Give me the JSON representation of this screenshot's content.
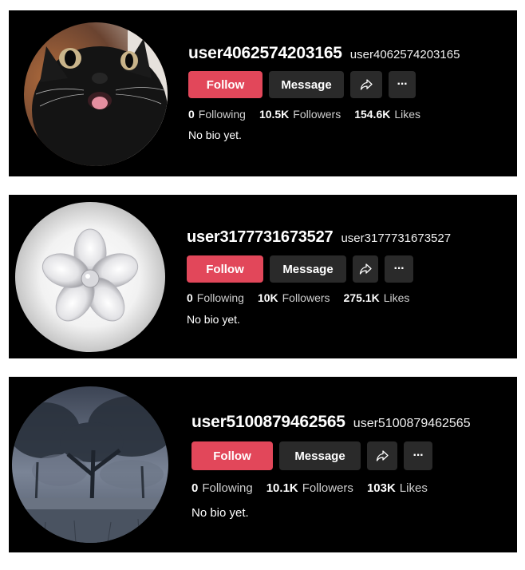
{
  "profiles": [
    {
      "username": "user4062574203165",
      "handle": "user4062574203165",
      "follow_label": "Follow",
      "message_label": "Message",
      "share_icon": "share-icon",
      "more_icon": "more-icon",
      "more_glyph": "···",
      "following_count": "0",
      "following_label": "Following",
      "followers_count": "10.5K",
      "followers_label": "Followers",
      "likes_count": "154.6K",
      "likes_label": "Likes",
      "bio": "No bio yet.",
      "avatar": "black-cat-photo"
    },
    {
      "username": "user3177731673527",
      "handle": "user3177731673527",
      "follow_label": "Follow",
      "message_label": "Message",
      "share_icon": "share-icon",
      "more_icon": "more-icon",
      "more_glyph": "···",
      "following_count": "0",
      "following_label": "Following",
      "followers_count": "10K",
      "followers_label": "Followers",
      "likes_count": "275.1K",
      "likes_label": "Likes",
      "bio": "No bio yet.",
      "avatar": "glass-flower-photo"
    },
    {
      "username": "user5100879462565",
      "handle": "user5100879462565",
      "follow_label": "Follow",
      "message_label": "Message",
      "share_icon": "share-icon",
      "more_icon": "more-icon",
      "more_glyph": "···",
      "following_count": "0",
      "following_label": "Following",
      "followers_count": "10.1K",
      "followers_label": "Followers",
      "likes_count": "103K",
      "likes_label": "Likes",
      "bio": "No bio yet.",
      "avatar": "misty-forest-photo"
    }
  ],
  "colors": {
    "card_bg": "#000000",
    "follow_bg": "#e2475a",
    "secondary_btn_bg": "#2a2a2a",
    "text": "#ffffff"
  }
}
